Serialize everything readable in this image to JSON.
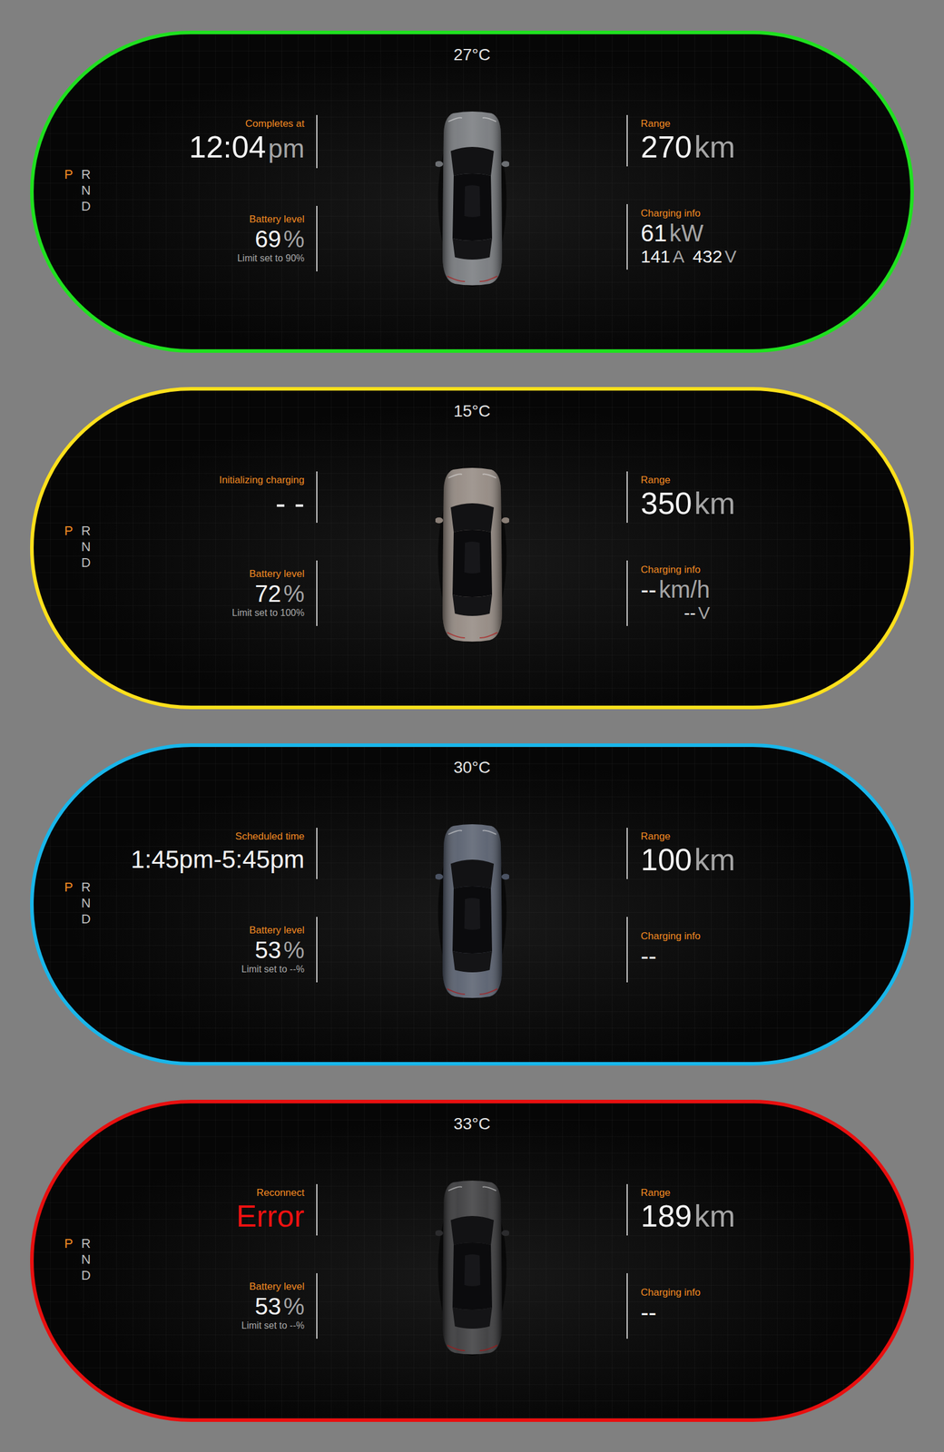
{
  "panels": [
    {
      "color": "#1fe01f",
      "temperature": "27°C",
      "gears": [
        {
          "label": "P",
          "selected": true
        },
        {
          "label": "R",
          "selected": false
        },
        {
          "label": "N",
          "selected": false
        },
        {
          "label": "D",
          "selected": false
        }
      ],
      "status": {
        "label": "Completes at",
        "value": "12:04",
        "unit": "pm",
        "kind": "time"
      },
      "battery": {
        "label": "Battery level",
        "value": "69",
        "unit": "%",
        "limit": "Limit set to 90%"
      },
      "car": {
        "color": "#6c6f73"
      },
      "range": {
        "label": "Range",
        "value": "270",
        "unit": "km"
      },
      "charging": {
        "label": "Charging info",
        "primary": [
          {
            "value": "61",
            "unit": "kW"
          }
        ],
        "secondary": [
          {
            "value": "141",
            "unit": "A"
          },
          {
            "value": "432",
            "unit": "V"
          }
        ]
      }
    },
    {
      "color": "#ffe01c",
      "temperature": "15°C",
      "gears": [
        {
          "label": "P",
          "selected": true
        },
        {
          "label": "R",
          "selected": false
        },
        {
          "label": "N",
          "selected": false
        },
        {
          "label": "D",
          "selected": false
        }
      ],
      "status": {
        "label": "Initializing charging",
        "value": "- -",
        "kind": "time"
      },
      "battery": {
        "label": "Battery level",
        "value": "72",
        "unit": "%",
        "limit": "Limit set to 100%"
      },
      "car": {
        "color": "#8a7f77"
      },
      "range": {
        "label": "Range",
        "value": "350",
        "unit": "km"
      },
      "charging": {
        "label": "Charging info",
        "primary": [
          {
            "value": "--",
            "unit": "km/h"
          }
        ],
        "secondary": [
          {
            "value": "--",
            "unit": "V"
          }
        ]
      }
    },
    {
      "color": "#19b6ea",
      "temperature": "30°C",
      "gears": [
        {
          "label": "P",
          "selected": true
        },
        {
          "label": "R",
          "selected": false
        },
        {
          "label": "N",
          "selected": false
        },
        {
          "label": "D",
          "selected": false
        }
      ],
      "status": {
        "label": "Scheduled time",
        "value": "1:45pm-5:45pm",
        "kind": "schedule"
      },
      "battery": {
        "label": "Battery level",
        "value": "53",
        "unit": "%",
        "limit": "Limit set to --%"
      },
      "car": {
        "color": "#4a5262"
      },
      "range": {
        "label": "Range",
        "value": "100",
        "unit": "km"
      },
      "charging": {
        "label": "Charging info",
        "primary": [
          {
            "value": "--"
          }
        ],
        "secondary": []
      }
    },
    {
      "color": "#e80f0f",
      "temperature": "33°C",
      "gears": [
        {
          "label": "P",
          "selected": true
        },
        {
          "label": "R",
          "selected": false
        },
        {
          "label": "N",
          "selected": false
        },
        {
          "label": "D",
          "selected": false
        }
      ],
      "status": {
        "label": "Reconnect",
        "value": "Error",
        "kind": "error"
      },
      "battery": {
        "label": "Battery level",
        "value": "53",
        "unit": "%",
        "limit": "Limit set to --%"
      },
      "car": {
        "color": "#2b2b2d"
      },
      "range": {
        "label": "Range",
        "value": "189",
        "unit": "km"
      },
      "charging": {
        "label": "Charging info",
        "primary": [
          {
            "value": "--"
          }
        ],
        "secondary": []
      }
    }
  ]
}
